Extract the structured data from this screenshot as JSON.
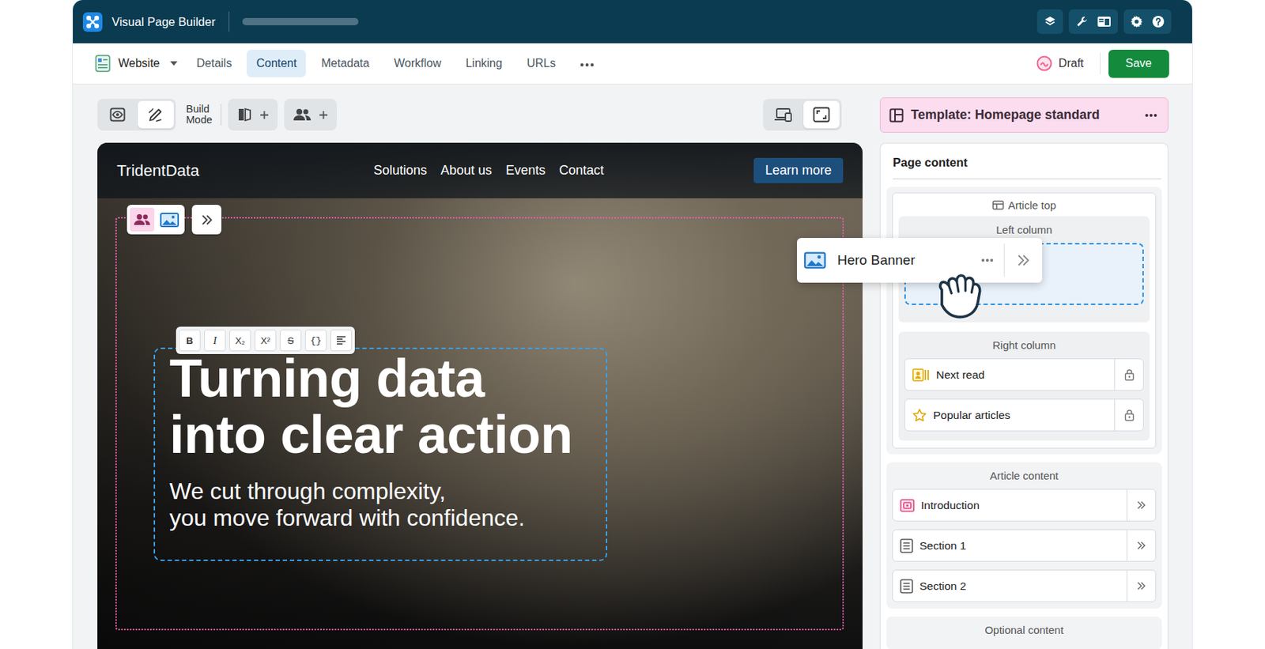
{
  "app": {
    "title": "Visual Page Builder"
  },
  "header": {
    "site": "Website",
    "tabs": [
      {
        "label": "Details",
        "selected": false
      },
      {
        "label": "Content",
        "selected": true
      },
      {
        "label": "Metadata",
        "selected": false
      },
      {
        "label": "Workflow",
        "selected": false
      },
      {
        "label": "Linking",
        "selected": false
      },
      {
        "label": "URLs",
        "selected": false
      }
    ],
    "status": "Draft",
    "save": "Save"
  },
  "toolbar": {
    "modes": [
      {
        "kind": "preview",
        "selected": false
      },
      {
        "kind": "build",
        "selected": true
      }
    ],
    "mode_label": "Build Mode",
    "views": [
      {
        "kind": "responsive",
        "selected": false
      },
      {
        "kind": "fullscreen",
        "selected": true
      }
    ]
  },
  "preview": {
    "brand": "TridentData",
    "links": [
      "Solutions",
      "About us",
      "Events",
      "Contact"
    ],
    "cta": "Learn more",
    "headline": [
      "Turning data",
      "into clear action"
    ],
    "subheadline": [
      "We cut through complexity,",
      "you move forward with confidence."
    ]
  },
  "format_toolbar": [
    {
      "label": "B",
      "kind": "bold"
    },
    {
      "label": "I",
      "kind": "italic"
    },
    {
      "label": "X₂",
      "kind": "subscript"
    },
    {
      "label": "X²",
      "kind": "superscript"
    },
    {
      "label": "S",
      "kind": "strike"
    },
    {
      "label": "{}",
      "kind": "code"
    }
  ],
  "dragging": {
    "label": "Hero Banner"
  },
  "template": {
    "title": "Template: Homepage standard"
  },
  "page_content": {
    "title": "Page content",
    "groups": [
      {
        "title": "Article top",
        "columns": [
          {
            "title": "Left column",
            "drop_target": true,
            "items": []
          },
          {
            "title": "Right column",
            "drop_target": false,
            "items": [
              {
                "label": "Next read",
                "kind": "next-read",
                "locked": true
              },
              {
                "label": "Popular articles",
                "kind": "popular",
                "locked": true
              }
            ]
          }
        ]
      },
      {
        "title": "Article content",
        "columns": [],
        "items": [
          {
            "label": "Introduction",
            "kind": "intro",
            "locked": false
          },
          {
            "label": "Section 1",
            "kind": "section",
            "locked": false
          },
          {
            "label": "Section 2",
            "kind": "section",
            "locked": false
          }
        ]
      },
      {
        "title": "Optional content",
        "columns": [],
        "items": []
      }
    ]
  }
}
